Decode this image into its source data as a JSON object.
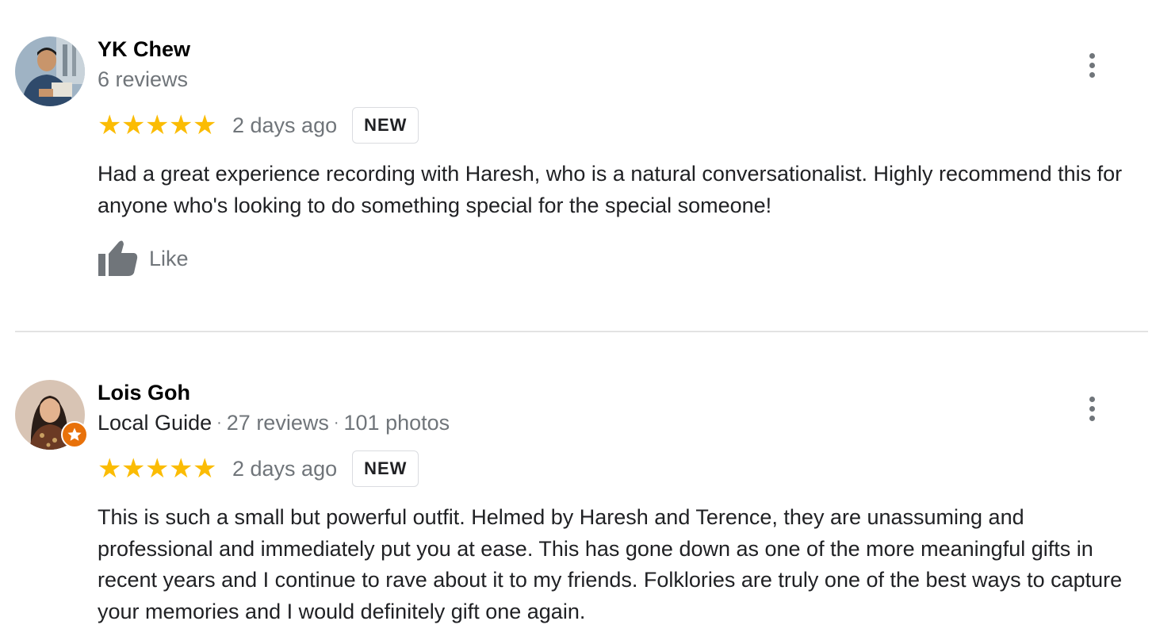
{
  "reviews": [
    {
      "name": "YK Chew",
      "meta": "6 reviews",
      "stars": [
        "★",
        "★",
        "★",
        "★",
        "★"
      ],
      "date": "2 days ago",
      "badge": "NEW",
      "text": "Had a great experience recording with Haresh, who is a natural conversationalist. Highly recommend this for anyone who's looking to do something special for the special someone!",
      "like_label": "Like"
    },
    {
      "name": "Lois Goh",
      "guide_label": "Local Guide",
      "separator": "·",
      "review_count": "27 reviews",
      "photo_count": "101 photos",
      "stars": [
        "★",
        "★",
        "★",
        "★",
        "★"
      ],
      "date": "2 days ago",
      "badge": "NEW",
      "text": "This is such a small but powerful outfit. Helmed by Haresh and Terence, they are unassuming and professional and immediately put you at ease. This has gone down as one of the more meaningful gifts in recent years and I continue to rave about it to my friends. Folklories are truly one of the best ways to capture your memories and I would definitely gift one again."
    }
  ],
  "icons": {
    "more": "more-vert-icon",
    "like": "thumb-up-icon",
    "star": "star-icon",
    "guide_badge": "local-guide-star-icon"
  },
  "colors": {
    "star": "#fbbc04",
    "muted_text": "#70757a",
    "guide_badge": "#e8710a"
  }
}
